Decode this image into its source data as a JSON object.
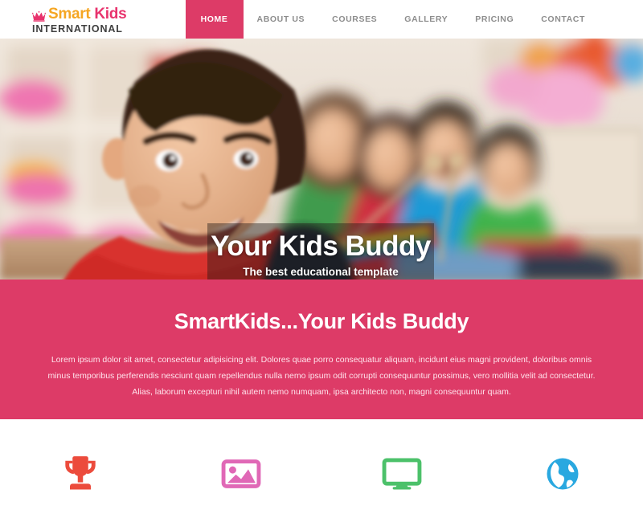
{
  "header": {
    "logo": {
      "crown_icon": "crown-icon",
      "word_smart": "Smart",
      "word_kids": "Kids",
      "subtitle": "INTERNATIONAL",
      "color_smart": "#f5a623",
      "color_kids": "#e8336d",
      "color_subtitle": "#3f3f3f",
      "crown_color": "#e8336d"
    },
    "nav": [
      {
        "label": "HOME",
        "active": true
      },
      {
        "label": "ABOUT US",
        "active": false
      },
      {
        "label": "COURSES",
        "active": false
      },
      {
        "label": "GALLERY",
        "active": false
      },
      {
        "label": "PRICING",
        "active": false
      },
      {
        "label": "CONTACT",
        "active": false
      }
    ],
    "active_color": "#dd3b67",
    "inactive_color": "#8d8d8d"
  },
  "hero": {
    "image_description": "Classroom of young children in colorful shirts playing xylophones, smiling boy in red shirt in foreground",
    "title": "Your Kids Buddy",
    "subtitle": "The best educational template",
    "slides": [
      {
        "index": 1,
        "active": true
      },
      {
        "index": 2,
        "active": false
      },
      {
        "index": 3,
        "active": false
      }
    ]
  },
  "intro": {
    "heading": "SmartKids...Your Kids Buddy",
    "paragraph": "Lorem ipsum dolor sit amet, consectetur adipisicing elit. Dolores quae porro consequatur aliquam, incidunt eius magni provident, doloribus omnis minus temporibus perferendis nesciunt quam repellendus nulla nemo ipsum odit corrupti consequuntur possimus, vero mollitia velit ad consectetur. Alias, laborum excepturi nihil autem nemo numquam, ipsa architecto non, magni consequuntur quam.",
    "background_color": "#dd3b67",
    "heading_color": "#ffffff",
    "text_color": "#ffe3ec"
  },
  "features": [
    {
      "icon": "trophy-icon",
      "color": "#ec4b3c"
    },
    {
      "icon": "image-icon",
      "color": "#e068b6"
    },
    {
      "icon": "monitor-icon",
      "color": "#4cc16a"
    },
    {
      "icon": "globe-icon",
      "color": "#29a8e0"
    }
  ]
}
